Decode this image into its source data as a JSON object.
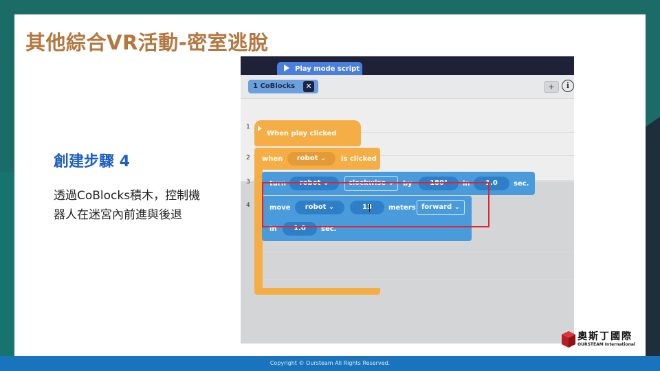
{
  "slide": {
    "title": "其他綜合VR活動-密室逃脫",
    "step_title": "創建步驟 4",
    "step_desc": "透過CoBlocks積木，控制機器人在迷宮內前進與後退"
  },
  "editor": {
    "play_tab_label": "Play mode script",
    "file_tab_label": "1  CoBlocks",
    "file_tab_close": "✕",
    "add_button": "+",
    "info_button": "i",
    "line_numbers": [
      "1",
      "2",
      "3",
      "4"
    ]
  },
  "blocks": {
    "when_play": "When play clicked",
    "when_label": "when",
    "when_target": "robot",
    "is_clicked": "is clicked",
    "turn_label": "turn",
    "turn_target": "robot",
    "turn_direction": "clockwise",
    "by_label": "by",
    "turn_angle": "180°",
    "in_label": "in",
    "turn_time": "1.0",
    "sec_label": "sec.",
    "move_label": "move",
    "move_target": "robot",
    "move_distance": "13",
    "meters_label": "meters",
    "move_direction": "forward",
    "move_in_label": "in",
    "move_time": "1.0",
    "move_sec_label": "sec."
  },
  "logo": {
    "name": "奧斯丁國際",
    "sub": "OURSTEAM International"
  },
  "footer": {
    "copyright": "Copyright © Oursteam All Rights Reserved."
  },
  "colors": {
    "title": "#b4773f",
    "step_title": "#1d5fbf",
    "block_orange": "#f5ae45",
    "block_blue": "#4a9bdc",
    "highlight": "#e0242b",
    "footer": "#1a74bd"
  }
}
